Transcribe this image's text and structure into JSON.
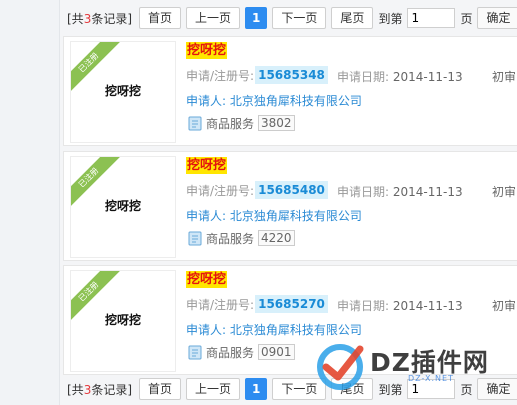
{
  "pagination": {
    "total_prefix": "[共",
    "total_count": "3",
    "total_suffix": "条记录]",
    "first": "首页",
    "prev": "上一页",
    "current": "1",
    "next": "下一页",
    "last": "尾页",
    "goto_prefix": "到第",
    "goto_value": "1",
    "goto_suffix": "页",
    "confirm": "确定"
  },
  "results": [
    {
      "ribbon": "已注册",
      "logo_text": "挖呀挖",
      "name": "挖呀挖",
      "regno_label": "申请/注册号:",
      "regno": "15685348",
      "date_label": "申请日期:",
      "date": "2014-11-13",
      "status": "初审",
      "applicant_label": "申请人:",
      "applicant": "北京独角犀科技有限公司",
      "goods_label": "商品服务",
      "goods_count": "3802"
    },
    {
      "ribbon": "已注册",
      "logo_text": "挖呀挖",
      "name": "挖呀挖",
      "regno_label": "申请/注册号:",
      "regno": "15685480",
      "date_label": "申请日期:",
      "date": "2014-11-13",
      "status": "初审",
      "applicant_label": "申请人:",
      "applicant": "北京独角犀科技有限公司",
      "goods_label": "商品服务",
      "goods_count": "4220"
    },
    {
      "ribbon": "已注册",
      "logo_text": "挖呀挖",
      "name": "挖呀挖",
      "regno_label": "申请/注册号:",
      "regno": "15685270",
      "date_label": "申请日期:",
      "date": "2014-11-13",
      "status": "初审",
      "applicant_label": "申请人:",
      "applicant": "北京独角犀科技有限公司",
      "goods_label": "商品服务",
      "goods_count": "0901"
    }
  ],
  "watermark": {
    "text": "DZ插件网",
    "url": "DZ-X.NET"
  },
  "colors": {
    "accent": "#2d8cf0",
    "highlight": "#ffe600",
    "name_red": "#e4130f",
    "link_blue": "#2a8ad4",
    "ribbon_green": "#8cc152"
  },
  "icons": {
    "goods": "document-icon",
    "watermark": "dz-check-logo-icon"
  }
}
